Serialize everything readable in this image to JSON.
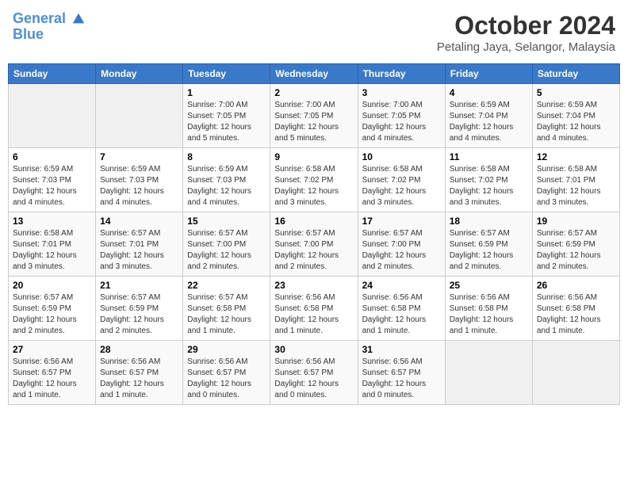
{
  "header": {
    "logo_line1": "General",
    "logo_line2": "Blue",
    "month": "October 2024",
    "location": "Petaling Jaya, Selangor, Malaysia"
  },
  "days_of_week": [
    "Sunday",
    "Monday",
    "Tuesday",
    "Wednesday",
    "Thursday",
    "Friday",
    "Saturday"
  ],
  "weeks": [
    [
      {
        "day": "",
        "detail": ""
      },
      {
        "day": "",
        "detail": ""
      },
      {
        "day": "1",
        "detail": "Sunrise: 7:00 AM\nSunset: 7:05 PM\nDaylight: 12 hours\nand 5 minutes."
      },
      {
        "day": "2",
        "detail": "Sunrise: 7:00 AM\nSunset: 7:05 PM\nDaylight: 12 hours\nand 5 minutes."
      },
      {
        "day": "3",
        "detail": "Sunrise: 7:00 AM\nSunset: 7:05 PM\nDaylight: 12 hours\nand 4 minutes."
      },
      {
        "day": "4",
        "detail": "Sunrise: 6:59 AM\nSunset: 7:04 PM\nDaylight: 12 hours\nand 4 minutes."
      },
      {
        "day": "5",
        "detail": "Sunrise: 6:59 AM\nSunset: 7:04 PM\nDaylight: 12 hours\nand 4 minutes."
      }
    ],
    [
      {
        "day": "6",
        "detail": "Sunrise: 6:59 AM\nSunset: 7:03 PM\nDaylight: 12 hours\nand 4 minutes."
      },
      {
        "day": "7",
        "detail": "Sunrise: 6:59 AM\nSunset: 7:03 PM\nDaylight: 12 hours\nand 4 minutes."
      },
      {
        "day": "8",
        "detail": "Sunrise: 6:59 AM\nSunset: 7:03 PM\nDaylight: 12 hours\nand 4 minutes."
      },
      {
        "day": "9",
        "detail": "Sunrise: 6:58 AM\nSunset: 7:02 PM\nDaylight: 12 hours\nand 3 minutes."
      },
      {
        "day": "10",
        "detail": "Sunrise: 6:58 AM\nSunset: 7:02 PM\nDaylight: 12 hours\nand 3 minutes."
      },
      {
        "day": "11",
        "detail": "Sunrise: 6:58 AM\nSunset: 7:02 PM\nDaylight: 12 hours\nand 3 minutes."
      },
      {
        "day": "12",
        "detail": "Sunrise: 6:58 AM\nSunset: 7:01 PM\nDaylight: 12 hours\nand 3 minutes."
      }
    ],
    [
      {
        "day": "13",
        "detail": "Sunrise: 6:58 AM\nSunset: 7:01 PM\nDaylight: 12 hours\nand 3 minutes."
      },
      {
        "day": "14",
        "detail": "Sunrise: 6:57 AM\nSunset: 7:01 PM\nDaylight: 12 hours\nand 3 minutes."
      },
      {
        "day": "15",
        "detail": "Sunrise: 6:57 AM\nSunset: 7:00 PM\nDaylight: 12 hours\nand 2 minutes."
      },
      {
        "day": "16",
        "detail": "Sunrise: 6:57 AM\nSunset: 7:00 PM\nDaylight: 12 hours\nand 2 minutes."
      },
      {
        "day": "17",
        "detail": "Sunrise: 6:57 AM\nSunset: 7:00 PM\nDaylight: 12 hours\nand 2 minutes."
      },
      {
        "day": "18",
        "detail": "Sunrise: 6:57 AM\nSunset: 6:59 PM\nDaylight: 12 hours\nand 2 minutes."
      },
      {
        "day": "19",
        "detail": "Sunrise: 6:57 AM\nSunset: 6:59 PM\nDaylight: 12 hours\nand 2 minutes."
      }
    ],
    [
      {
        "day": "20",
        "detail": "Sunrise: 6:57 AM\nSunset: 6:59 PM\nDaylight: 12 hours\nand 2 minutes."
      },
      {
        "day": "21",
        "detail": "Sunrise: 6:57 AM\nSunset: 6:59 PM\nDaylight: 12 hours\nand 2 minutes."
      },
      {
        "day": "22",
        "detail": "Sunrise: 6:57 AM\nSunset: 6:58 PM\nDaylight: 12 hours\nand 1 minute."
      },
      {
        "day": "23",
        "detail": "Sunrise: 6:56 AM\nSunset: 6:58 PM\nDaylight: 12 hours\nand 1 minute."
      },
      {
        "day": "24",
        "detail": "Sunrise: 6:56 AM\nSunset: 6:58 PM\nDaylight: 12 hours\nand 1 minute."
      },
      {
        "day": "25",
        "detail": "Sunrise: 6:56 AM\nSunset: 6:58 PM\nDaylight: 12 hours\nand 1 minute."
      },
      {
        "day": "26",
        "detail": "Sunrise: 6:56 AM\nSunset: 6:58 PM\nDaylight: 12 hours\nand 1 minute."
      }
    ],
    [
      {
        "day": "27",
        "detail": "Sunrise: 6:56 AM\nSunset: 6:57 PM\nDaylight: 12 hours\nand 1 minute."
      },
      {
        "day": "28",
        "detail": "Sunrise: 6:56 AM\nSunset: 6:57 PM\nDaylight: 12 hours\nand 1 minute."
      },
      {
        "day": "29",
        "detail": "Sunrise: 6:56 AM\nSunset: 6:57 PM\nDaylight: 12 hours\nand 0 minutes."
      },
      {
        "day": "30",
        "detail": "Sunrise: 6:56 AM\nSunset: 6:57 PM\nDaylight: 12 hours\nand 0 minutes."
      },
      {
        "day": "31",
        "detail": "Sunrise: 6:56 AM\nSunset: 6:57 PM\nDaylight: 12 hours\nand 0 minutes."
      },
      {
        "day": "",
        "detail": ""
      },
      {
        "day": "",
        "detail": ""
      }
    ]
  ]
}
